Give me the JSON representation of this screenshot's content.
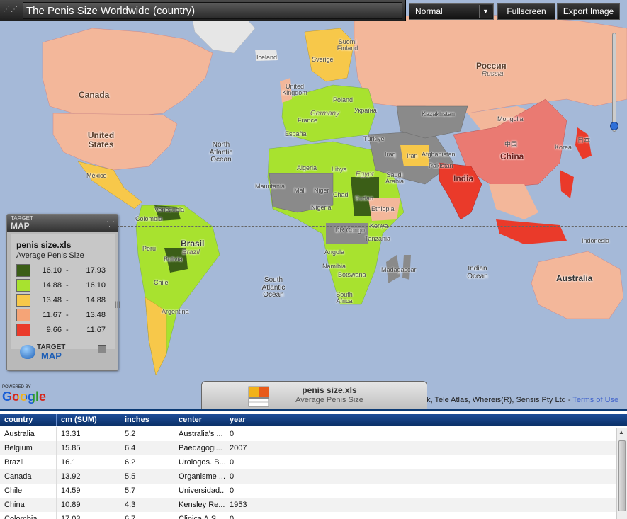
{
  "title": "The Penis Size Worldwide (country)",
  "toolbar": {
    "mode": "Normal",
    "fullscreen_label": "Fullscreen",
    "export_label": "Export Image"
  },
  "map_labels": {
    "russia": "Россия",
    "russia_en": "Russia",
    "china_cn": "中国",
    "china": "China",
    "india": "India",
    "canada": "Canada",
    "us": "United States",
    "mexico": "México",
    "brazil": "Brasil",
    "brazil_en": "Brazil",
    "australia": "Australia",
    "kazakhstan": "Kazakhstan",
    "mongolia": "Mongolia",
    "sudan": "Sudan",
    "algeria": "Algeria",
    "libya": "Libya",
    "egypt": "Egypt",
    "mali": "Mali",
    "niger": "Niger",
    "chad": "Chad",
    "nigeria": "Nigeria",
    "ethiopia": "Ethiopia",
    "kenya": "Kenya",
    "tanzania": "Tanzania",
    "angola": "Angola",
    "namibia": "Namibia",
    "botswana": "Botswana",
    "madagascar": "Madagascar",
    "south_africa": "South Africa",
    "dr_congo": "DR Congo",
    "mauritania": "Mauritania",
    "saudi": "Saudi Arabia",
    "iran": "Iran",
    "iraq": "Iraq",
    "turkey": "Türkiye",
    "afghanistan": "Afghanistan",
    "pakistan": "Pakistan",
    "ukraine": "Україна",
    "poland": "Poland",
    "germany": "Germany",
    "france": "France",
    "spain": "España",
    "uk": "United Kingdom",
    "iceland": "Iceland",
    "finland": "Suomi Finland",
    "sverige": "Sverige",
    "venezuela": "Venezuela",
    "colombia": "Colombia",
    "peru": "Perú",
    "bolivia": "Bolivia",
    "chile": "Chile",
    "argentina": "Argentina",
    "indonesia": "Indonesia",
    "japan": "日本",
    "korea": "Korea",
    "north_atlantic": "North Atlantic Ocean",
    "south_atlantic": "South Atlantic Ocean",
    "indian_ocean": "Indian Ocean"
  },
  "legend": {
    "brand_top": "TARGET",
    "brand_bottom": "MAP",
    "file": "penis size.xls",
    "subtitle": "Average Penis Size",
    "ranges": [
      {
        "low": "16.10",
        "high": "17.93",
        "color": "#3b5e17"
      },
      {
        "low": "14.88",
        "high": "16.10",
        "color": "#a8e22f"
      },
      {
        "low": "13.48",
        "high": "14.88",
        "color": "#f7c84a"
      },
      {
        "low": "11.67",
        "high": "13.48",
        "color": "#f5a477"
      },
      {
        "low": "9.66",
        "high": "11.67",
        "color": "#ea3a2a"
      }
    ],
    "logo_top": "TARGET",
    "logo_bottom": "MAP"
  },
  "google": {
    "powered": "POWERED BY",
    "word": "Google"
  },
  "attribution": {
    "text": "nk, Tele Atlas, Whereis(R), Sensis Pty Ltd - ",
    "tos": "Terms of Use"
  },
  "dataset_tab": {
    "name": "penis size.xls",
    "subtitle": "Average Penis Size"
  },
  "table": {
    "columns": [
      "country",
      "cm (SUM)",
      "inches",
      "center",
      "year"
    ],
    "rows": [
      [
        "Australia",
        "13.31",
        "5.2",
        "Australia's ...",
        "0"
      ],
      [
        "Belgium",
        "15.85",
        "6.4",
        "Paedagogi...",
        "2007"
      ],
      [
        "Brazil",
        "16.1",
        "6.2",
        "Urologos. B...",
        "0"
      ],
      [
        "Canada",
        "13.92",
        "5.5",
        "Organisme ...",
        "0"
      ],
      [
        "Chile",
        "14.59",
        "5.7",
        "Universidad...",
        "0"
      ],
      [
        "China",
        "10.89",
        "4.3",
        "Kensley Re...",
        "1953"
      ],
      [
        "Colombia",
        "17.03",
        "6.7",
        "Clinica A.S...",
        "0"
      ]
    ]
  }
}
